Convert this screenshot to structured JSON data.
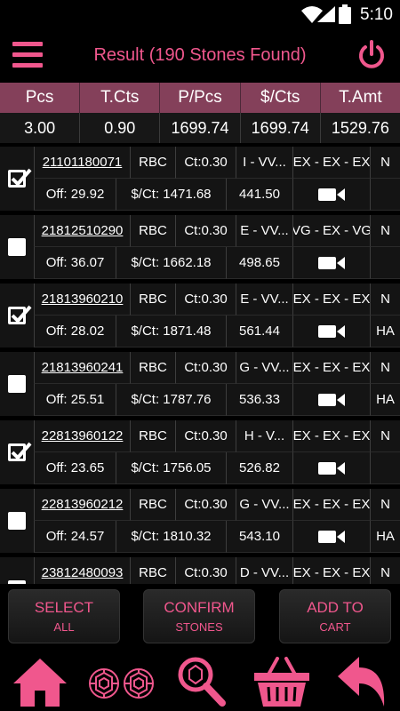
{
  "status": {
    "time": "5:10"
  },
  "header": {
    "title": "Result (190 Stones Found)"
  },
  "summary": {
    "headers": [
      "Pcs",
      "T.Cts",
      "P/Pcs",
      "$/Cts",
      "T.Amt"
    ],
    "values": [
      "3.00",
      "0.90",
      "1699.74",
      "1699.74",
      "1529.76"
    ]
  },
  "items": [
    {
      "stone_id": "21101180071",
      "shape": "RBC",
      "carat": "Ct:0.30",
      "color_clarity": "I - VV...",
      "cut_polish_sym": "EX - EX - EX",
      "fluor": "N",
      "discount": "Off: 29.92",
      "price_per_ct": "$/Ct: 1471.68",
      "amount": "441.50",
      "lab": "",
      "checked": true
    },
    {
      "stone_id": "21812510290",
      "shape": "RBC",
      "carat": "Ct:0.30",
      "color_clarity": "E - VV...",
      "cut_polish_sym": "VG - EX - VG",
      "fluor": "N",
      "discount": "Off: 36.07",
      "price_per_ct": "$/Ct: 1662.18",
      "amount": "498.65",
      "lab": "",
      "checked": false
    },
    {
      "stone_id": "21813960210",
      "shape": "RBC",
      "carat": "Ct:0.30",
      "color_clarity": "E - VV...",
      "cut_polish_sym": "EX - EX - EX",
      "fluor": "N",
      "discount": "Off: 28.02",
      "price_per_ct": "$/Ct: 1871.48",
      "amount": "561.44",
      "lab": "HA",
      "checked": true
    },
    {
      "stone_id": "21813960241",
      "shape": "RBC",
      "carat": "Ct:0.30",
      "color_clarity": "G - VV...",
      "cut_polish_sym": "EX - EX - EX",
      "fluor": "N",
      "discount": "Off: 25.51",
      "price_per_ct": "$/Ct: 1787.76",
      "amount": "536.33",
      "lab": "HA",
      "checked": false
    },
    {
      "stone_id": "22813960122",
      "shape": "RBC",
      "carat": "Ct:0.30",
      "color_clarity": "H - V...",
      "cut_polish_sym": "EX - EX - EX",
      "fluor": "N",
      "discount": "Off: 23.65",
      "price_per_ct": "$/Ct: 1756.05",
      "amount": "526.82",
      "lab": "",
      "checked": true
    },
    {
      "stone_id": "22813960212",
      "shape": "RBC",
      "carat": "Ct:0.30",
      "color_clarity": "G - VV...",
      "cut_polish_sym": "EX - EX - EX",
      "fluor": "N",
      "discount": "Off: 24.57",
      "price_per_ct": "$/Ct: 1810.32",
      "amount": "543.10",
      "lab": "HA",
      "checked": false
    },
    {
      "stone_id": "23812480093",
      "shape": "RBC",
      "carat": "Ct:0.30",
      "color_clarity": "D - VV...",
      "cut_polish_sym": "EX - EX - EX",
      "fluor": "N",
      "discount": "",
      "price_per_ct": "",
      "amount": "",
      "lab": "",
      "checked": false
    }
  ],
  "buttons": {
    "select_all": {
      "line1": "SELECT",
      "line2": "ALL"
    },
    "confirm": {
      "line1": "CONFIRM",
      "line2": "STONES"
    },
    "add_to_cart": {
      "line1": "ADD TO",
      "line2": "CART"
    }
  },
  "nav": [
    "home-icon",
    "diamonds-icon",
    "search-icon",
    "basket-icon",
    "back-icon"
  ],
  "colors": {
    "accent": "#f0578d",
    "header_bg": "#84405a",
    "row_bg": "#141414"
  }
}
